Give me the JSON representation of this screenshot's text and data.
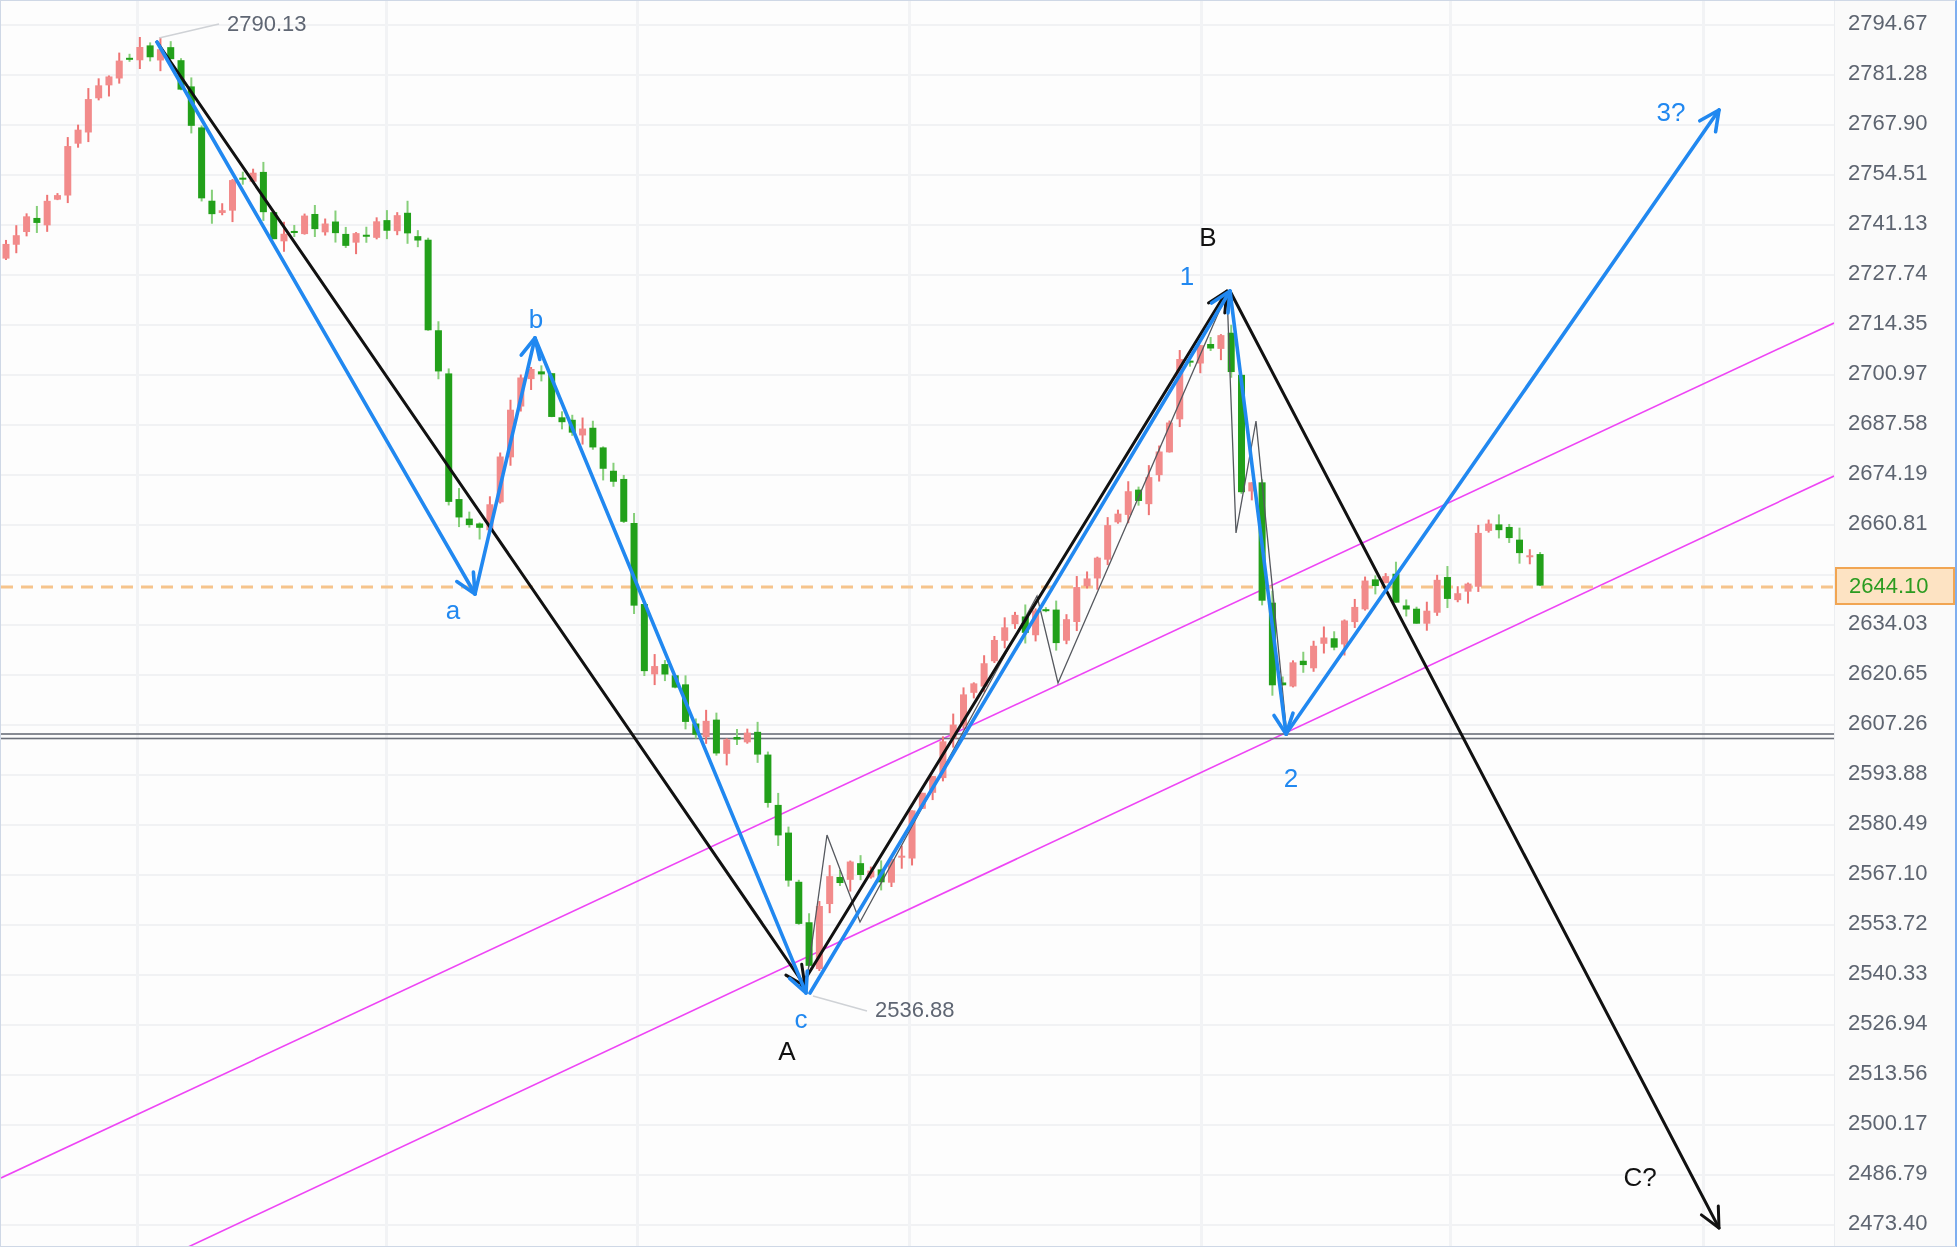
{
  "chart": {
    "price_labels": [
      "2790.13",
      "2536.88"
    ],
    "wave_labels": [
      {
        "text": "a",
        "color": "#2188f0"
      },
      {
        "text": "b",
        "color": "#2188f0"
      },
      {
        "text": "c",
        "color": "#2188f0"
      },
      {
        "text": "A",
        "color": "#111111"
      },
      {
        "text": "1",
        "color": "#2188f0"
      },
      {
        "text": "B",
        "color": "#111111"
      },
      {
        "text": "2",
        "color": "#2188f0"
      },
      {
        "text": "3?",
        "color": "#2188f0"
      },
      {
        "text": "C?",
        "color": "#111111"
      }
    ]
  },
  "price_axis": {
    "upper_labels": [
      "2794.67",
      "2781.28",
      "2767.90",
      "2754.51",
      "2741.13",
      "2727.74",
      "2714.35",
      "2700.97",
      "2687.58",
      "2674.19",
      "2660.81"
    ],
    "current_price": "2644.10",
    "lower_labels": [
      "2634.03",
      "2620.65",
      "2607.26",
      "2593.88",
      "2580.49",
      "2567.10",
      "2553.72",
      "2540.33",
      "2526.94",
      "2513.56",
      "2500.17",
      "2486.79",
      "2473.40"
    ]
  }
}
